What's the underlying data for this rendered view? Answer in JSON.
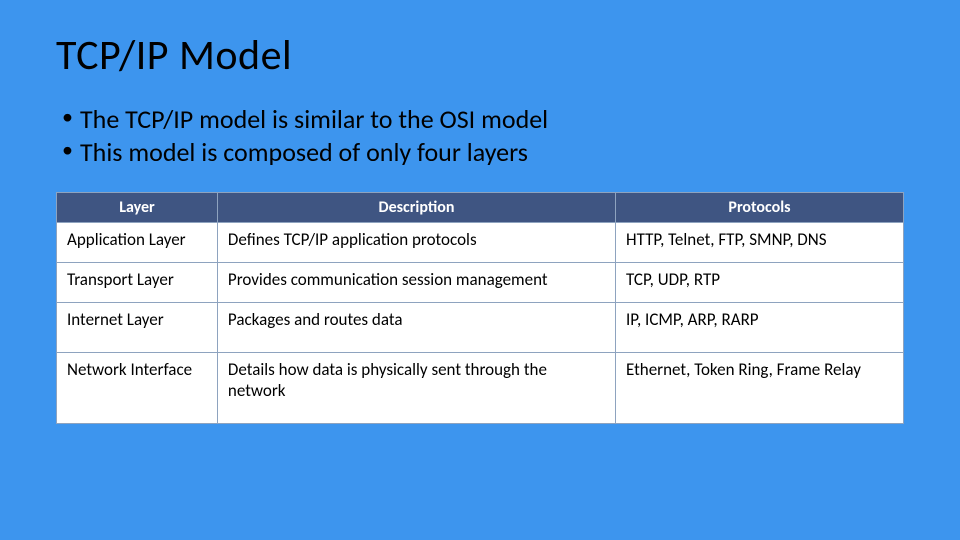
{
  "title": "TCP/IP Model",
  "bullets": [
    "The TCP/IP model is similar to the OSI model",
    "This model is composed of only four layers"
  ],
  "table": {
    "headers": [
      "Layer",
      "Description",
      "Protocols"
    ],
    "rows": [
      {
        "layer": "Application Layer",
        "description": "Defines TCP/IP application protocols",
        "protocols": "HTTP, Telnet, FTP, SMNP, DNS"
      },
      {
        "layer": "Transport Layer",
        "description": "Provides communication session management",
        "protocols": "TCP, UDP, RTP"
      },
      {
        "layer": "Internet Layer",
        "description": "Packages  and routes data",
        "protocols": "IP, ICMP, ARP, RARP"
      },
      {
        "layer": "Network Interface",
        "description": "Details how data is physically sent through the network",
        "protocols": "Ethernet, Token Ring, Frame Relay"
      }
    ]
  },
  "colors": {
    "background": "#3d95ee",
    "header_bg": "#3f5582"
  }
}
